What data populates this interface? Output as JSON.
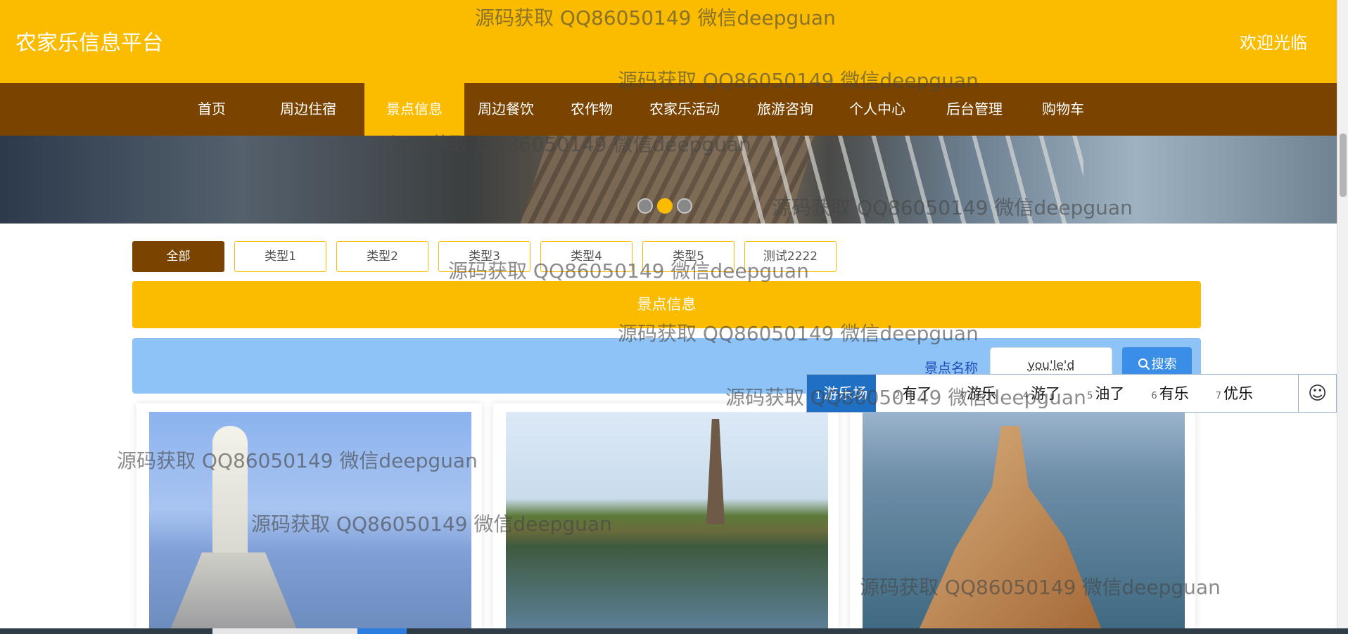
{
  "header": {
    "site_title": "农家乐信息平台",
    "welcome": "欢迎光临"
  },
  "nav": {
    "items": [
      {
        "label": "首页"
      },
      {
        "label": "周边住宿"
      },
      {
        "label": "景点信息"
      },
      {
        "label": "周边餐饮"
      },
      {
        "label": "农作物"
      },
      {
        "label": "农家乐活动"
      },
      {
        "label": "旅游咨询"
      },
      {
        "label": "个人中心"
      },
      {
        "label": "后台管理"
      },
      {
        "label": "购物车"
      }
    ],
    "active": "景点信息"
  },
  "carousel": {
    "slide_count": 3,
    "active_index": 2
  },
  "filters": {
    "items": [
      "全部",
      "类型1",
      "类型2",
      "类型3",
      "类型4",
      "类型5",
      "测试2222"
    ],
    "active": "全部"
  },
  "section": {
    "title": "景点信息"
  },
  "search": {
    "label": "景点名称",
    "value": "you'le'd",
    "button_label": "搜索"
  },
  "ime": {
    "candidates": [
      {
        "num": "1",
        "text": "游乐场"
      },
      {
        "num": "2",
        "text": "有了"
      },
      {
        "num": "3",
        "text": "游乐"
      },
      {
        "num": "4",
        "text": "游了"
      },
      {
        "num": "5",
        "text": "油了"
      },
      {
        "num": "6",
        "text": "有乐"
      },
      {
        "num": "7",
        "text": "优乐"
      }
    ],
    "emoji_icon": "smiley-icon"
  },
  "watermark": {
    "text": "源码获取 QQ86050149 微信deepguan"
  },
  "colors": {
    "accent": "#fbbc00",
    "nav_bg": "#7a4400",
    "search_bg": "#8ec3f7",
    "search_button": "#3a8ee6"
  }
}
